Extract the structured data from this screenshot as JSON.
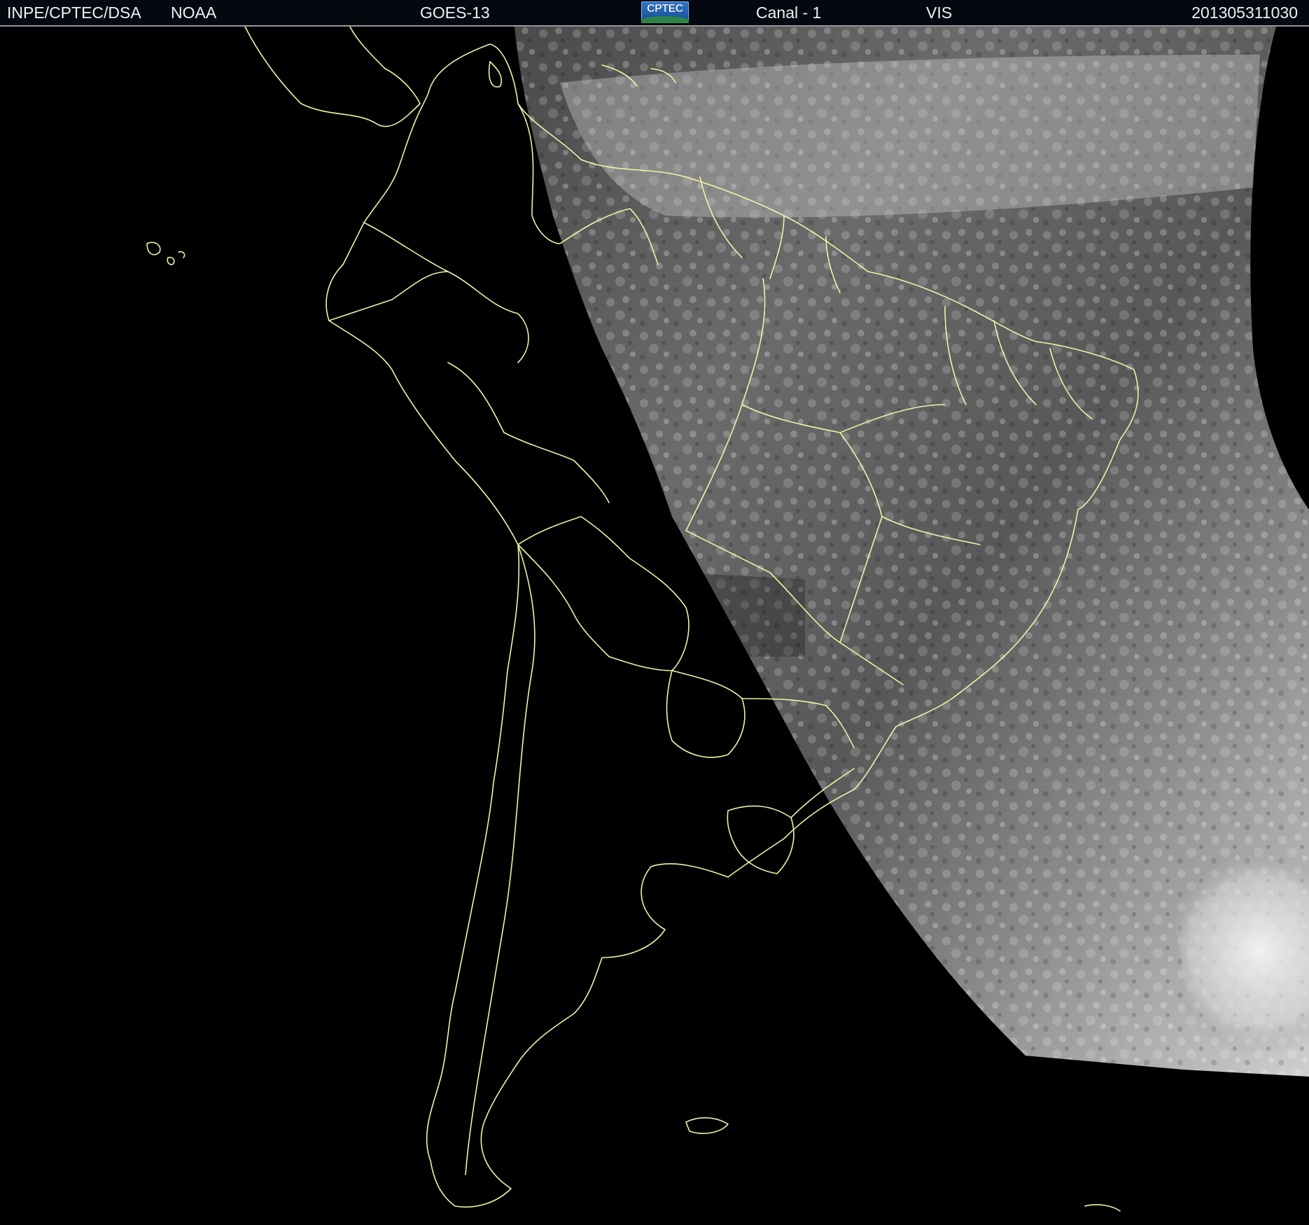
{
  "header": {
    "organization": "INPE/CPTEC/DSA",
    "agency": "NOAA",
    "satellite": "GOES-13",
    "logo_text": "CPTEC",
    "channel": "Canal - 1",
    "band": "VIS",
    "timestamp": "201305311030"
  },
  "map": {
    "background_color": "#000000",
    "border_color": "#f4f1a8",
    "cloud_light": "#f0f0f0",
    "cloud_dark": "#3c3c3c"
  }
}
